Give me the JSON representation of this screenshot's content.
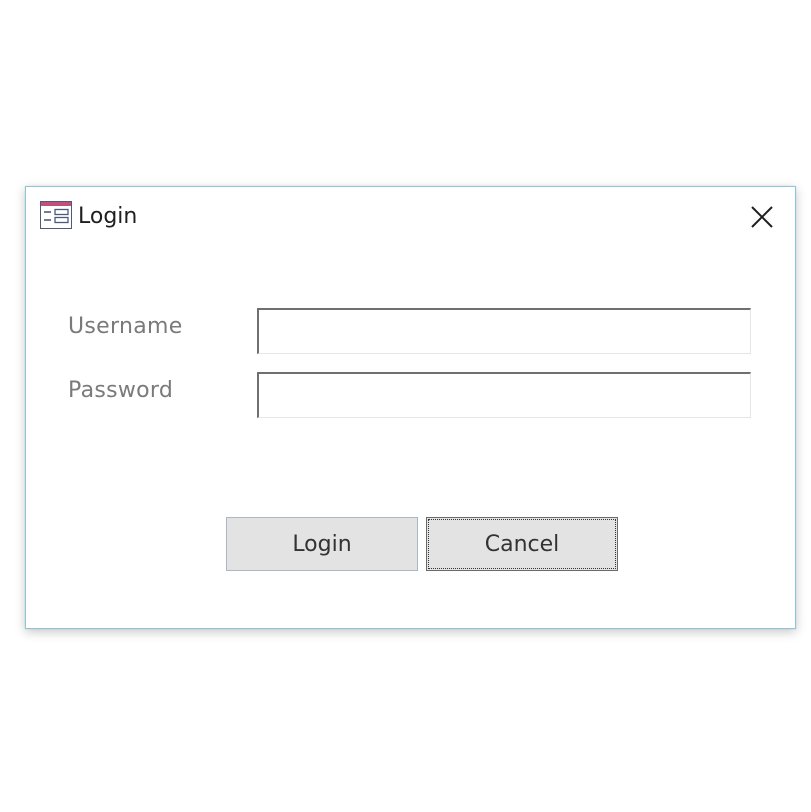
{
  "dialog": {
    "title": "Login",
    "icon": "form-window-icon",
    "close_icon": "close-icon"
  },
  "form": {
    "username_label": "Username",
    "username_value": "",
    "password_label": "Password",
    "password_value": ""
  },
  "buttons": {
    "login_label": "Login",
    "cancel_label": "Cancel"
  },
  "colors": {
    "border_accent": "#8ec6d9",
    "icon_accent": "#c0507a",
    "button_face": "#e3e3e3",
    "label_text": "#7a7a7a"
  }
}
